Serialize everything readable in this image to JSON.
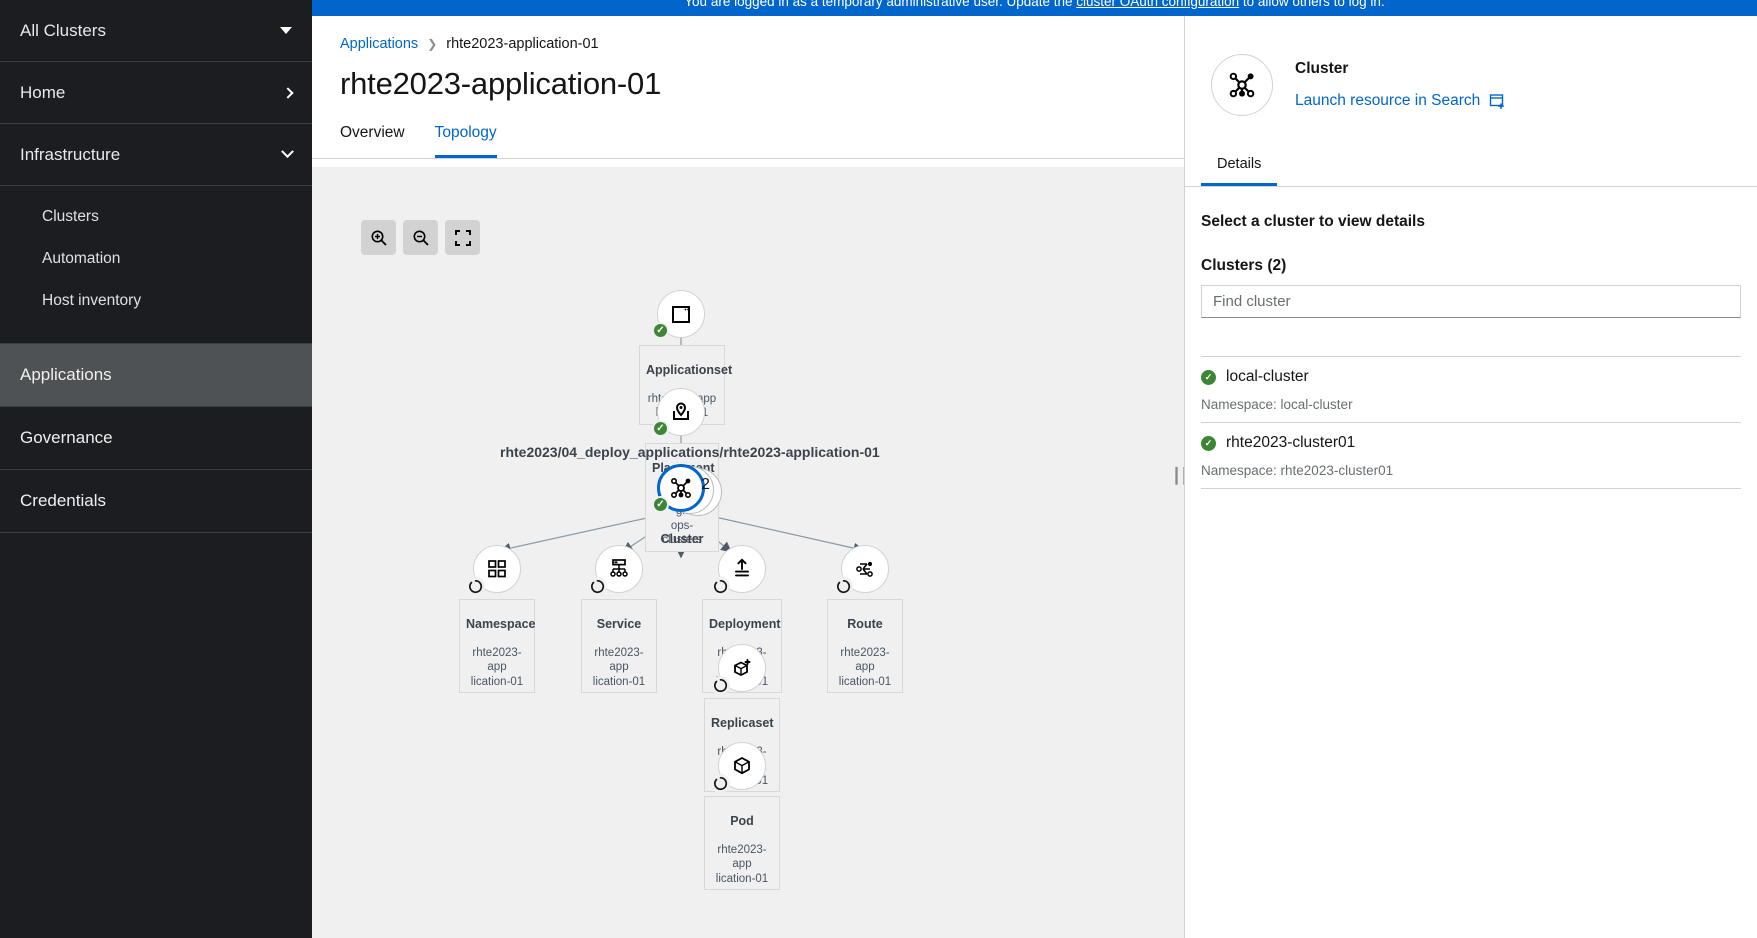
{
  "banner": {
    "text_before": "You are logged in as a temporary administrative user. Update the ",
    "link": "cluster OAuth configuration",
    "text_after": " to allow others to log in."
  },
  "sidebar": {
    "cluster_selector": "All Clusters",
    "home": "Home",
    "infrastructure": "Infrastructure",
    "infra_children": [
      "Clusters",
      "Automation",
      "Host inventory"
    ],
    "nav": [
      "Applications",
      "Governance",
      "Credentials"
    ],
    "active_nav": "Applications"
  },
  "breadcrumb": {
    "parent": "Applications",
    "current": "rhte2023-application-01"
  },
  "page": {
    "title": "rhte2023-application-01",
    "tabs": [
      {
        "label": "Overview",
        "active": false
      },
      {
        "label": "Topology",
        "active": true
      }
    ]
  },
  "topology": {
    "zoom_controls": [
      "zoom-in-icon",
      "zoom-out-icon",
      "fit-to-screen-icon"
    ],
    "edge_label": "rhte2023/04_deploy_applications/rhte2023-application-01",
    "cluster_count": "2",
    "nodes": [
      {
        "kind": "Applicationset",
        "name": "rhte2023-app\nlication-01",
        "status": "success",
        "icon": "applicationset-icon"
      },
      {
        "kind": "Placement",
        "name": "rhte2023-git\nops-clusters",
        "status": "success",
        "icon": "placement-icon"
      },
      {
        "kind": "Cluster",
        "name": "",
        "status": "success",
        "icon": "cluster-icon"
      },
      {
        "kind": "Namespace",
        "name": "rhte2023-app\nlication-01",
        "status": "pending",
        "icon": "namespace-icon"
      },
      {
        "kind": "Service",
        "name": "rhte2023-app\nlication-01",
        "status": "pending",
        "icon": "service-icon"
      },
      {
        "kind": "Deployment",
        "name": "rhte2023-app\nlication-01",
        "status": "pending",
        "icon": "deployment-icon"
      },
      {
        "kind": "Route",
        "name": "rhte2023-app\nlication-01",
        "status": "pending",
        "icon": "route-icon"
      },
      {
        "kind": "Replicaset",
        "name": "rhte2023-app\nlication-01",
        "status": "pending",
        "icon": "replicaset-icon"
      },
      {
        "kind": "Pod",
        "name": "rhte2023-app\nlication-01",
        "status": "pending",
        "icon": "pod-icon"
      }
    ]
  },
  "details_panel": {
    "kind": "Cluster",
    "launch_link": "Launch resource in Search",
    "tab": "Details",
    "heading": "Select a cluster to view details",
    "clusters_heading": "Clusters (2)",
    "find_placeholder": "Find cluster",
    "find_value": "",
    "clusters": [
      {
        "name": "local-cluster",
        "namespace": "Namespace: local-cluster",
        "status": "success"
      },
      {
        "name": "rhte2023-cluster01",
        "namespace": "Namespace: rhte2023-cluster01",
        "status": "success"
      }
    ]
  },
  "colors": {
    "accent": "#0066cc",
    "success": "#3e8635",
    "sidebar_bg": "#1b1d21",
    "canvas_bg": "#f0f0f0"
  }
}
